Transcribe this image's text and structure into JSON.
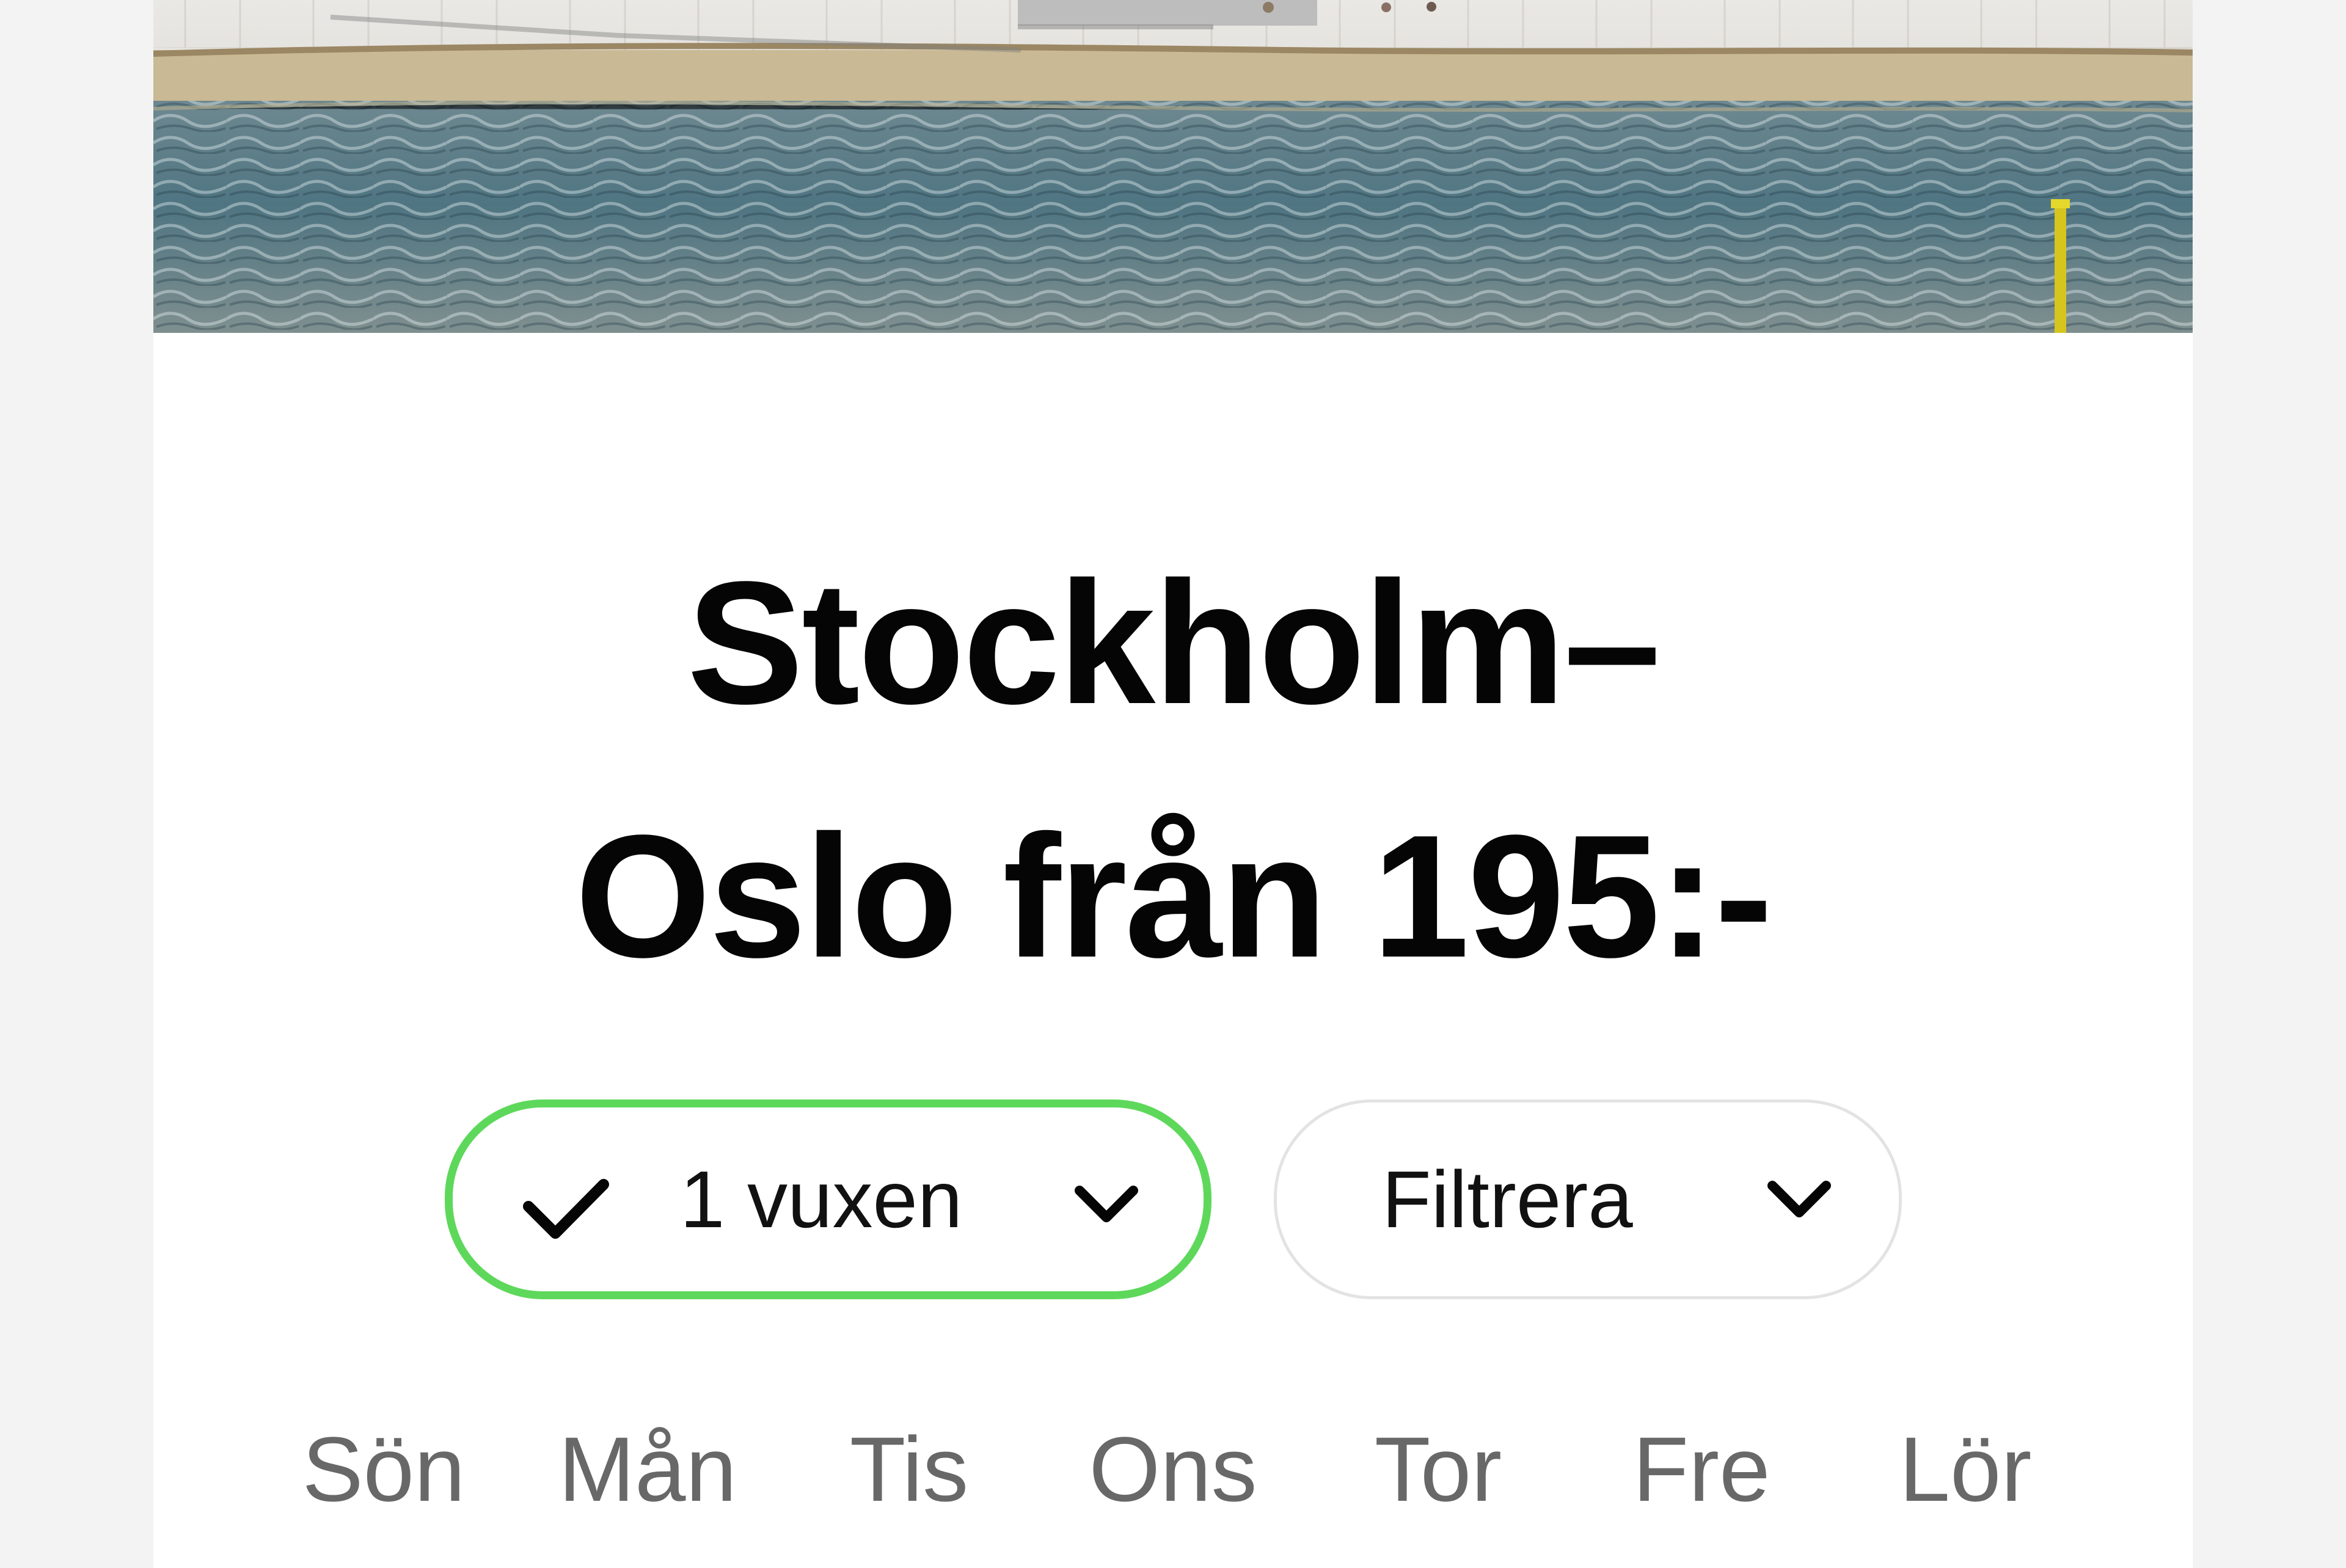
{
  "page": {
    "background": "#f3f3f3",
    "card_background": "#ffffff"
  },
  "hero": {
    "image_subject": "sunlit-plaza-and-rippling-water",
    "colors": {
      "plaza": "#d9d8d2",
      "edge": "#ad9b74",
      "water": "#577983",
      "post": "#d3c51d"
    }
  },
  "route": {
    "title": "Stockholm–\nOslo från 195:-"
  },
  "passengers": {
    "icon": "check-icon",
    "label": "1 vuxen",
    "dropdown_icon": "chevron-down-icon",
    "selected": true,
    "border_color": "#5ed85b"
  },
  "filter": {
    "label": "Filtrera",
    "dropdown_icon": "chevron-down-icon",
    "border_color": "#e3e3e3"
  },
  "weekdays": [
    "Sön",
    "Mån",
    "Tis",
    "Ons",
    "Tor",
    "Fre",
    "Lör"
  ]
}
